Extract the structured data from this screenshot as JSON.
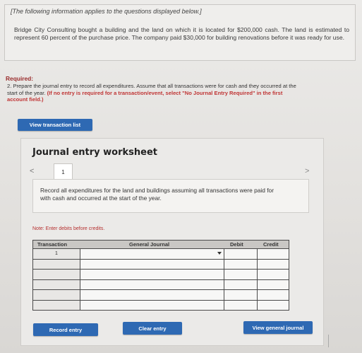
{
  "info": {
    "intro": "[The following information applies to the questions displayed below.]",
    "body": "Bridge City Consulting bought a building and the land on which it is located for $200,000 cash. The land is estimated to represent 60 percent of the purchase price. The company paid $30,000 for building renovations before it was ready for use."
  },
  "required": {
    "label": "Required:",
    "text": "2. Prepare the journal entry to record all expenditures. Assume that all transactions were for cash and they occurred at the start of the year.",
    "note_red": "(If no entry is required for a transaction/event, select \"No Journal Entry Required\" in the first account field.)"
  },
  "buttons": {
    "view_transaction_list": "View transaction list",
    "record_entry": "Record entry",
    "clear_entry": "Clear entry",
    "view_general_journal": "View general journal"
  },
  "worksheet": {
    "title": "Journal entry worksheet",
    "tab": "1",
    "nav_prev": "<",
    "nav_next": ">",
    "instruction": "Record all expenditures for the land and buildings assuming all transactions were paid for with cash and occurred at the start of the year.",
    "note": "Note: Enter debits before credits."
  },
  "table": {
    "headers": {
      "transaction": "Transaction",
      "general_journal": "General Journal",
      "debit": "Debit",
      "credit": "Credit"
    },
    "rows": [
      "1",
      "",
      "",
      "",
      "",
      ""
    ]
  }
}
